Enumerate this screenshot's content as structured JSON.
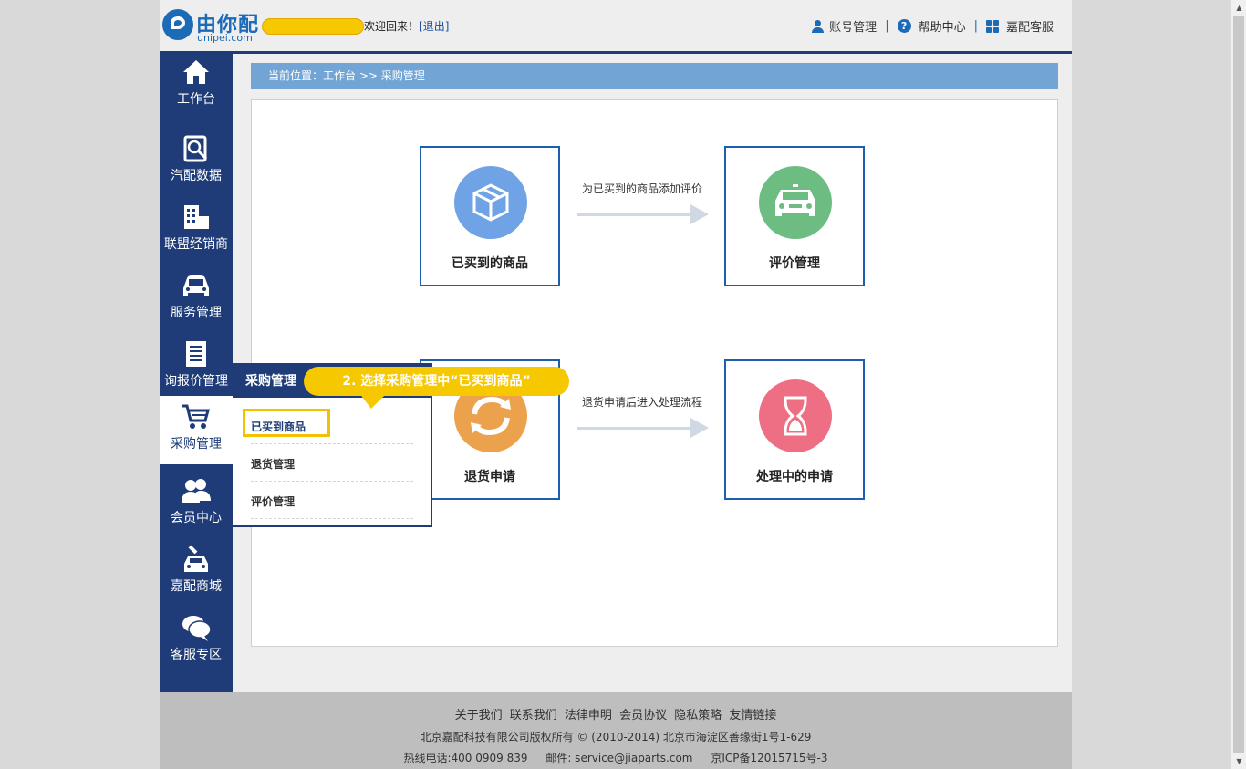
{
  "header": {
    "logo_cn": "由你配",
    "logo_en": "unipei.com",
    "welcome": "欢迎回来！",
    "logout": "[退出]",
    "nav": [
      {
        "label": "账号管理",
        "icon": "user-icon"
      },
      {
        "label": "帮助中心",
        "icon": "help-icon"
      },
      {
        "label": "嘉配客服",
        "icon": "grid-icon"
      }
    ],
    "help_glyph": "?"
  },
  "sidebar": {
    "items": [
      {
        "label": "工作台",
        "icon": "home-icon"
      },
      {
        "label": "汽配数据",
        "icon": "search-doc-icon"
      },
      {
        "label": "联盟经销商",
        "icon": "building-icon"
      },
      {
        "label": "服务管理",
        "icon": "car-icon"
      },
      {
        "label": "询报价管理",
        "icon": "document-icon"
      },
      {
        "label": "采购管理",
        "icon": "cart-icon",
        "active": true
      },
      {
        "label": "会员中心",
        "icon": "members-icon"
      },
      {
        "label": "嘉配商城",
        "icon": "shop-car-icon"
      },
      {
        "label": "客服专区",
        "icon": "chat-icon"
      }
    ]
  },
  "breadcrumb": "当前位置：工作台 >> 采购管理",
  "flow": {
    "cards": [
      {
        "title": "已买到的商品",
        "color": "#6fa3e6",
        "icon": "box-icon"
      },
      {
        "title": "评价管理",
        "color": "#6dbd83",
        "icon": "car-front-icon"
      },
      {
        "title": "退货申请",
        "color": "#eca14c",
        "icon": "refresh-icon"
      },
      {
        "title": "处理中的申请",
        "color": "#ee6f84",
        "icon": "hourglass-icon"
      }
    ],
    "arrows": [
      {
        "label": "为已买到的商品添加评价"
      },
      {
        "label": "退货申请后进入处理流程"
      }
    ]
  },
  "dropdown": {
    "title": "采购管理",
    "items": [
      "已买到商品",
      "退货管理",
      "评价管理"
    ]
  },
  "callout": "2. 选择采购管理中“已买到商品”",
  "footer": {
    "links": [
      "关于我们",
      "联系我们",
      "法律申明",
      "会员协议",
      "隐私策略",
      "友情链接"
    ],
    "copyright": "北京嘉配科技有限公司版权所有 © (2010-2014) 北京市海淀区善缘街1号1-629",
    "hotline": "热线电话:400 0909 839",
    "email": "邮件: service@jiaparts.com",
    "icp": "京ICP备12015715号-3"
  }
}
